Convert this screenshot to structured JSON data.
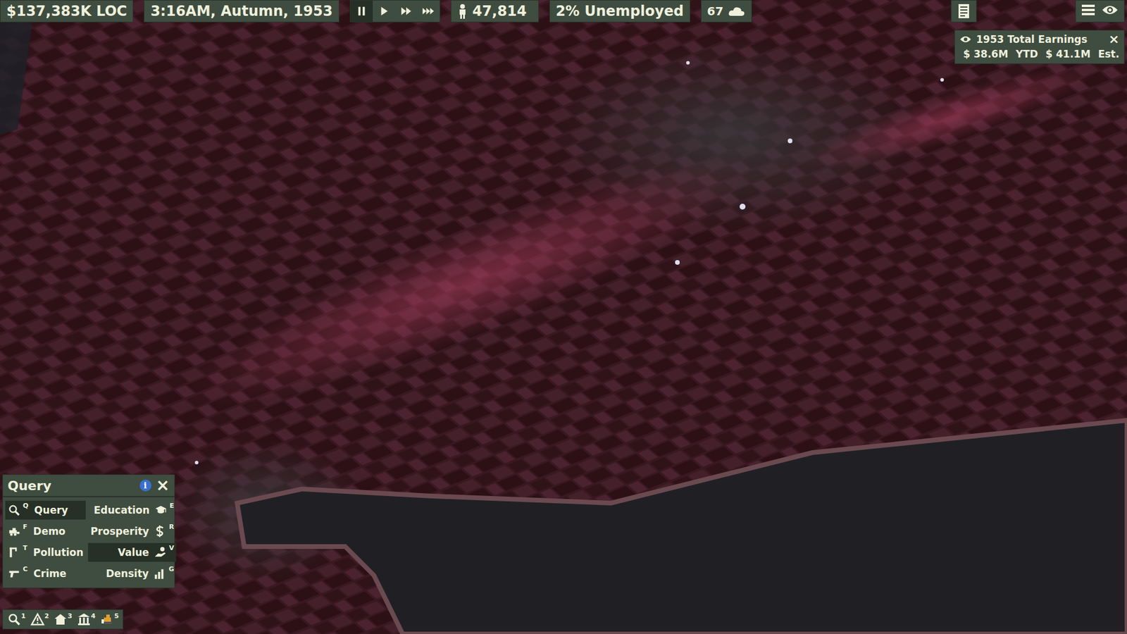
{
  "top_bar": {
    "money": "$137,383K LOC",
    "time": "3:16AM, Autumn, 1953",
    "speed": [
      {
        "kind": "pause",
        "selected": true
      },
      {
        "kind": "play",
        "selected": false
      },
      {
        "kind": "fast",
        "selected": false
      },
      {
        "kind": "fastest",
        "selected": false
      }
    ],
    "population": "47,814",
    "unemployment": "2% Unemployed",
    "weather": "67"
  },
  "earnings": {
    "title": "1953 Total Earnings",
    "close": "×",
    "ytd_value": "$ 38.6M",
    "ytd_label": "YTD",
    "est_value": "$ 41.1M",
    "est_label": "Est."
  },
  "query_panel": {
    "title": "Query",
    "info": "i",
    "close": "×",
    "modes": [
      {
        "label": "Query",
        "hotkey": "Q",
        "kind": "query",
        "selected": true
      },
      {
        "label": "Education",
        "hotkey": "E",
        "kind": "education",
        "selected": false
      },
      {
        "label": "Demo",
        "hotkey": "F",
        "kind": "demo",
        "selected": false
      },
      {
        "label": "Prosperity",
        "hotkey": "R",
        "kind": "prosperity",
        "selected": false
      },
      {
        "label": "Pollution",
        "hotkey": "T",
        "kind": "pollution",
        "selected": false
      },
      {
        "label": "Value",
        "hotkey": "V",
        "kind": "value",
        "selected": true
      },
      {
        "label": "Crime",
        "hotkey": "C",
        "kind": "crime",
        "selected": false
      },
      {
        "label": "Density",
        "hotkey": "G",
        "kind": "density",
        "selected": false
      }
    ]
  },
  "toolbar": [
    {
      "hotkey": "1",
      "kind": "query"
    },
    {
      "hotkey": "2",
      "kind": "road"
    },
    {
      "hotkey": "3",
      "kind": "zone"
    },
    {
      "hotkey": "4",
      "kind": "building"
    },
    {
      "hotkey": "5",
      "kind": "bulldoze"
    }
  ]
}
